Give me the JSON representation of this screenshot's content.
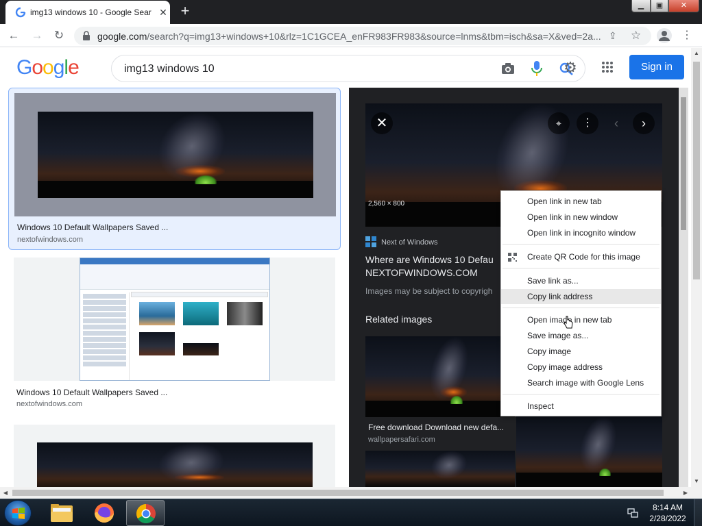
{
  "browser": {
    "tab_title": "img13 windows 10 - Google Sear",
    "tab_close": "✕",
    "new_tab": "+",
    "url_host": "google.com",
    "url_rest": "/search?q=img13+windows+10&rlz=1C1GCEA_enFR983FR983&source=lnms&tbm=isch&sa=X&ved=2a...",
    "window_controls": {
      "minimize": "▁",
      "maximize": "▣",
      "close": "✕"
    }
  },
  "google": {
    "logo": [
      "G",
      "o",
      "o",
      "g",
      "l",
      "e"
    ],
    "logo_colors": [
      "#4285F4",
      "#EA4335",
      "#FBBC05",
      "#4285F4",
      "#34A853",
      "#EA4335"
    ],
    "query": "img13 windows 10",
    "signin": "Sign in"
  },
  "results": [
    {
      "title": "Windows 10 Default Wallpapers Saved ...",
      "source": "nextofwindows.com"
    },
    {
      "title": "Windows 10 Default Wallpapers Saved ...",
      "source": "nextofwindows.com"
    }
  ],
  "preview": {
    "dimensions": "2,560 × 800",
    "site": "Next of Windows",
    "title_line1": "Where are Windows 10 Defau",
    "title_line2": "NEXTOFWINDOWS.COM",
    "copyright": "Images may be subject to copyrigh",
    "related_heading": "Related images",
    "related1_title": "Free download Download new defa...",
    "related1_source": "wallpapersafari.com"
  },
  "context_menu": {
    "items": [
      "Open link in new tab",
      "Open link in new window",
      "Open link in incognito window",
      "Create QR Code for this image",
      "Save link as...",
      "Copy link address",
      "Open image in new tab",
      "Save image as...",
      "Copy image",
      "Copy image address",
      "Search image with Google Lens",
      "Inspect"
    ],
    "hovered_item": "Copy link address"
  },
  "taskbar": {
    "time": "8:14 AM",
    "date": "2/28/2022",
    "apps": [
      "file-explorer",
      "firefox",
      "chrome"
    ],
    "active_app": "chrome"
  },
  "colors": {
    "accent_blue": "#1a73e8",
    "preview_bg": "#202124",
    "selected_card_bg": "#e8f0fe",
    "selected_card_border": "#8ab4f8"
  }
}
